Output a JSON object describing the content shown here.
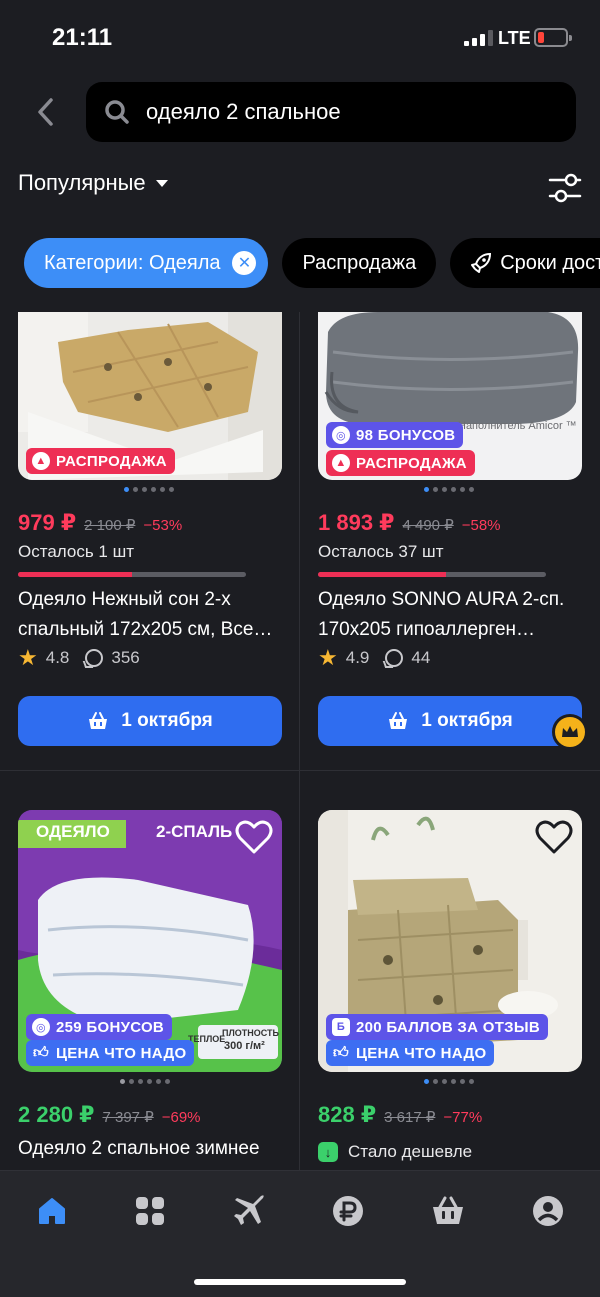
{
  "status": {
    "time": "21:11",
    "network": "LTE"
  },
  "search": {
    "query": "одеяло 2 спальное"
  },
  "sort": {
    "label": "Популярные"
  },
  "chips": [
    {
      "label": "Категории: Одеяла",
      "active": true
    },
    {
      "label": "Распродажа",
      "active": false
    },
    {
      "label": "Сроки доставки",
      "active": false,
      "icon": "rocket-icon"
    }
  ],
  "products": [
    {
      "badges": [
        "РАСПРОДАЖА"
      ],
      "price": "979 ₽",
      "old_price": "2 100 ₽",
      "discount": "−53%",
      "stock": "Осталось 1 шт",
      "stock_progress": 0.5,
      "title": "Одеяло Нежный сон 2-х спальный 172х205 см, Все…",
      "rating": "4.8",
      "reviews": "356",
      "cta": "1 октября"
    },
    {
      "badges": [
        "98 БОНУСОВ",
        "РАСПРОДАЖА"
      ],
      "image_text": "Наполнитель Amicor ™",
      "price": "1 893 ₽",
      "old_price": "4 490 ₽",
      "discount": "−58%",
      "stock": "Осталось 37 шт",
      "stock_progress": 0.56,
      "title": "Одеяло SONNO AURA 2-сп. 170х205 гипоаллерген…",
      "rating": "4.9",
      "reviews": "44",
      "cta": "1 октября"
    },
    {
      "image_labels": {
        "tag": "ОДЕЯЛО",
        "size": "2-СПАЛЬ",
        "density_label": "ПЛОТНОСТЬ",
        "density": "300 г/м²",
        "type": "ТЕПЛОЕ"
      },
      "badges": [
        "259 БОНУСОВ",
        "ЦЕНА ЧТО НАДО"
      ],
      "price": "2 280 ₽",
      "old_price": "7 397 ₽",
      "discount": "−69%",
      "title": "Одеяло 2 спальное зимнее"
    },
    {
      "badges": [
        "200 БАЛЛОВ ЗА ОТЗЫВ",
        "ЦЕНА ЧТО НАДО"
      ],
      "price": "828 ₽",
      "old_price": "3 617 ₽",
      "discount": "−77%",
      "note": "Стало дешевле"
    }
  ],
  "colors": {
    "accent": "#3d8ef7",
    "sale": "#ee2f55",
    "cta": "#2f6df0",
    "price_green": "#3bd06b"
  },
  "tabs": [
    "home-icon",
    "catalog-icon",
    "travel-icon",
    "finance-icon",
    "cart-icon",
    "profile-icon"
  ]
}
